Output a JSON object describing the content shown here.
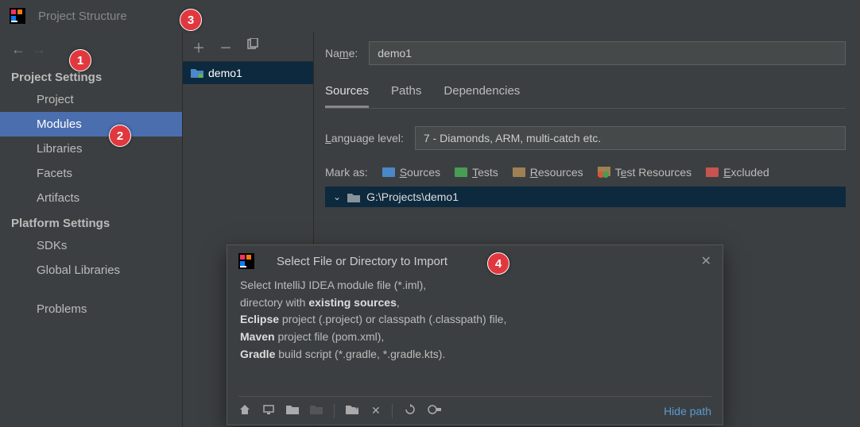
{
  "title": "Project Structure",
  "sections": {
    "project_settings": "Project Settings",
    "platform_settings": "Platform Settings"
  },
  "sidebar": {
    "items": [
      {
        "label": "Project"
      },
      {
        "label": "Modules"
      },
      {
        "label": "Libraries"
      },
      {
        "label": "Facets"
      },
      {
        "label": "Artifacts"
      }
    ],
    "platform_items": [
      {
        "label": "SDKs"
      },
      {
        "label": "Global Libraries"
      }
    ],
    "problems": "Problems"
  },
  "module": {
    "name": "demo1"
  },
  "name_label": "Name:",
  "name_value": "demo1",
  "tabs": {
    "sources": "Sources",
    "paths": "Paths",
    "deps": "Dependencies"
  },
  "lang_label": "Language level:",
  "lang_value": "7 - Diamonds, ARM, multi-catch etc.",
  "markas": {
    "label": "Mark as:",
    "sources": "Sources",
    "tests": "Tests",
    "resources": "Resources",
    "test_resources": "Test Resources",
    "excluded": "Excluded"
  },
  "tree_root": "G:\\Projects\\demo1",
  "dialog": {
    "title": "Select File or Directory to Import",
    "line1": "Select IntelliJ IDEA module file (*.iml),",
    "line2a": "directory with ",
    "line2b": "existing sources",
    "line2c": ",",
    "line3a": "Eclipse",
    "line3b": " project (.project) or classpath (.classpath) file,",
    "line4a": "Maven",
    "line4b": " project file (pom.xml),",
    "line5a": "Gradle",
    "line5b": " build script (*.gradle, *.gradle.kts).",
    "hide_path": "Hide path"
  },
  "callouts": {
    "c1": "1",
    "c2": "2",
    "c3": "3",
    "c4": "4"
  }
}
